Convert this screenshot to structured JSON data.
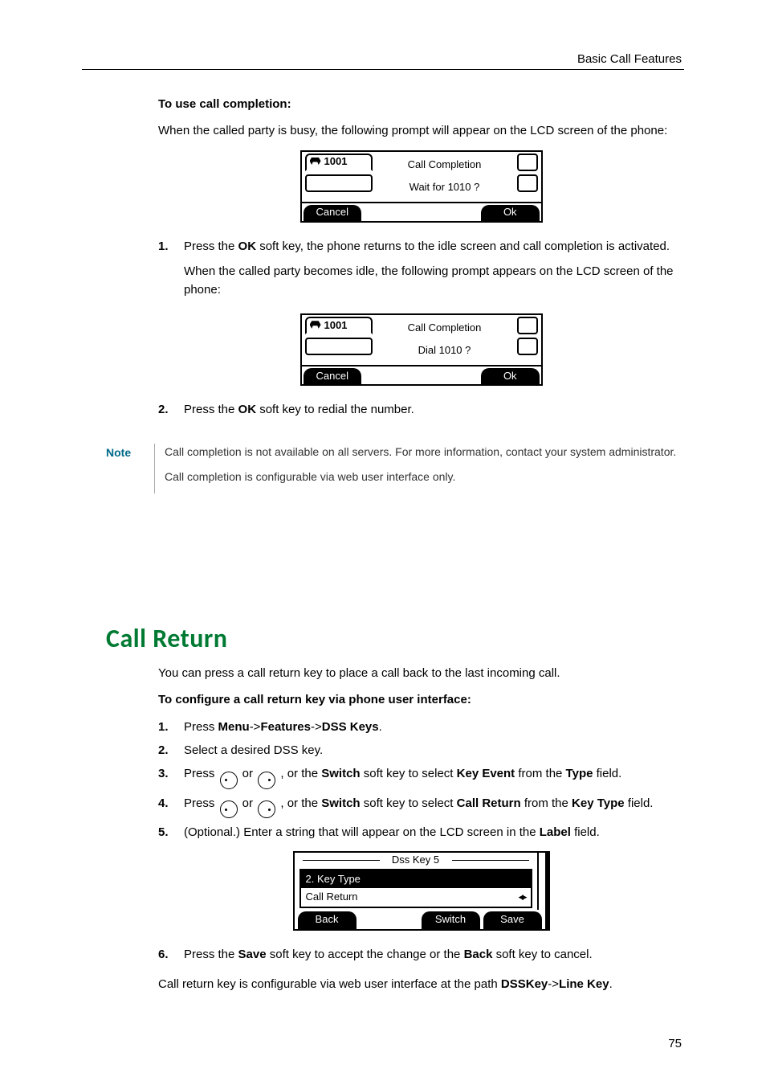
{
  "header": {
    "title": "Basic Call Features"
  },
  "page_number": "75",
  "intro": {
    "heading": "To use call completion:",
    "para": "When the called party is busy, the following prompt will appear on the LCD screen of the phone:"
  },
  "lcd1": {
    "tab": "1001",
    "center1": "Call Completion",
    "center2": "Wait for 1010 ?",
    "soft_left": "Cancel",
    "soft_right": "Ok"
  },
  "steps_a": [
    {
      "num": "1.",
      "pre": "Press the ",
      "bold": "OK",
      "post": " soft key, the phone returns to the idle screen and call completion is activated.",
      "sub": "When the called party becomes idle, the following prompt appears on the LCD screen of the phone:"
    }
  ],
  "lcd2": {
    "tab": "1001",
    "center1": "Call Completion",
    "center2": "Dial 1010 ?",
    "soft_left": "Cancel",
    "soft_right": "Ok"
  },
  "steps_b": [
    {
      "num": "2.",
      "pre": "Press the ",
      "bold": "OK",
      "post": " soft key to redial the number."
    }
  ],
  "note": {
    "label": "Note",
    "line1": "Call completion is not available on all servers. For more information, contact your system administrator.",
    "line2": "Call completion is configurable via web user interface only."
  },
  "section_heading": "Call Return",
  "call_return": {
    "intro": "You can press a call return key to place a call back to the last incoming call.",
    "config_heading": "To configure a call return key via phone user interface:"
  },
  "cr_steps": {
    "s1": {
      "num": "1.",
      "pre": "Press ",
      "b1": "Menu",
      "mid1": "->",
      "b2": "Features",
      "mid2": "->",
      "b3": "DSS Keys",
      "post": "."
    },
    "s2": {
      "num": "2.",
      "text": "Select a desired DSS key."
    },
    "s3": {
      "num": "3.",
      "pre": "Press ",
      "or": " or ",
      "mid": " , or the ",
      "bswitch": "Switch",
      "mid2": " soft key to select ",
      "bval": "Key Event",
      "mid3": " from the ",
      "bfield": "Type",
      "post": " field."
    },
    "s4": {
      "num": "4.",
      "pre": "Press ",
      "or": " or ",
      "mid": " , or the ",
      "bswitch": "Switch",
      "mid2": " soft key to select ",
      "bval": "Call Return",
      "mid3": " from the ",
      "bfield": "Key Type",
      "post": " field."
    },
    "s5": {
      "num": "5.",
      "pre": "(Optional.) Enter a string that will appear on the LCD screen in the ",
      "bfield": "Label",
      "post": " field."
    },
    "s6": {
      "num": "6.",
      "pre": "Press the ",
      "b1": "Save",
      "mid": " soft key to accept the change or the ",
      "b2": "Back",
      "post": " soft key to cancel."
    }
  },
  "dss_lcd": {
    "title": "Dss Key 5",
    "line1": "2. Key Type",
    "line2": "Call Return",
    "soft1": "Back",
    "soft3": "Switch",
    "soft4": "Save"
  },
  "outro": {
    "pre": "Call return key is configurable via web user interface at the path ",
    "b1": "DSSKey",
    "mid": "->",
    "b2": "Line Key",
    "post": "."
  }
}
